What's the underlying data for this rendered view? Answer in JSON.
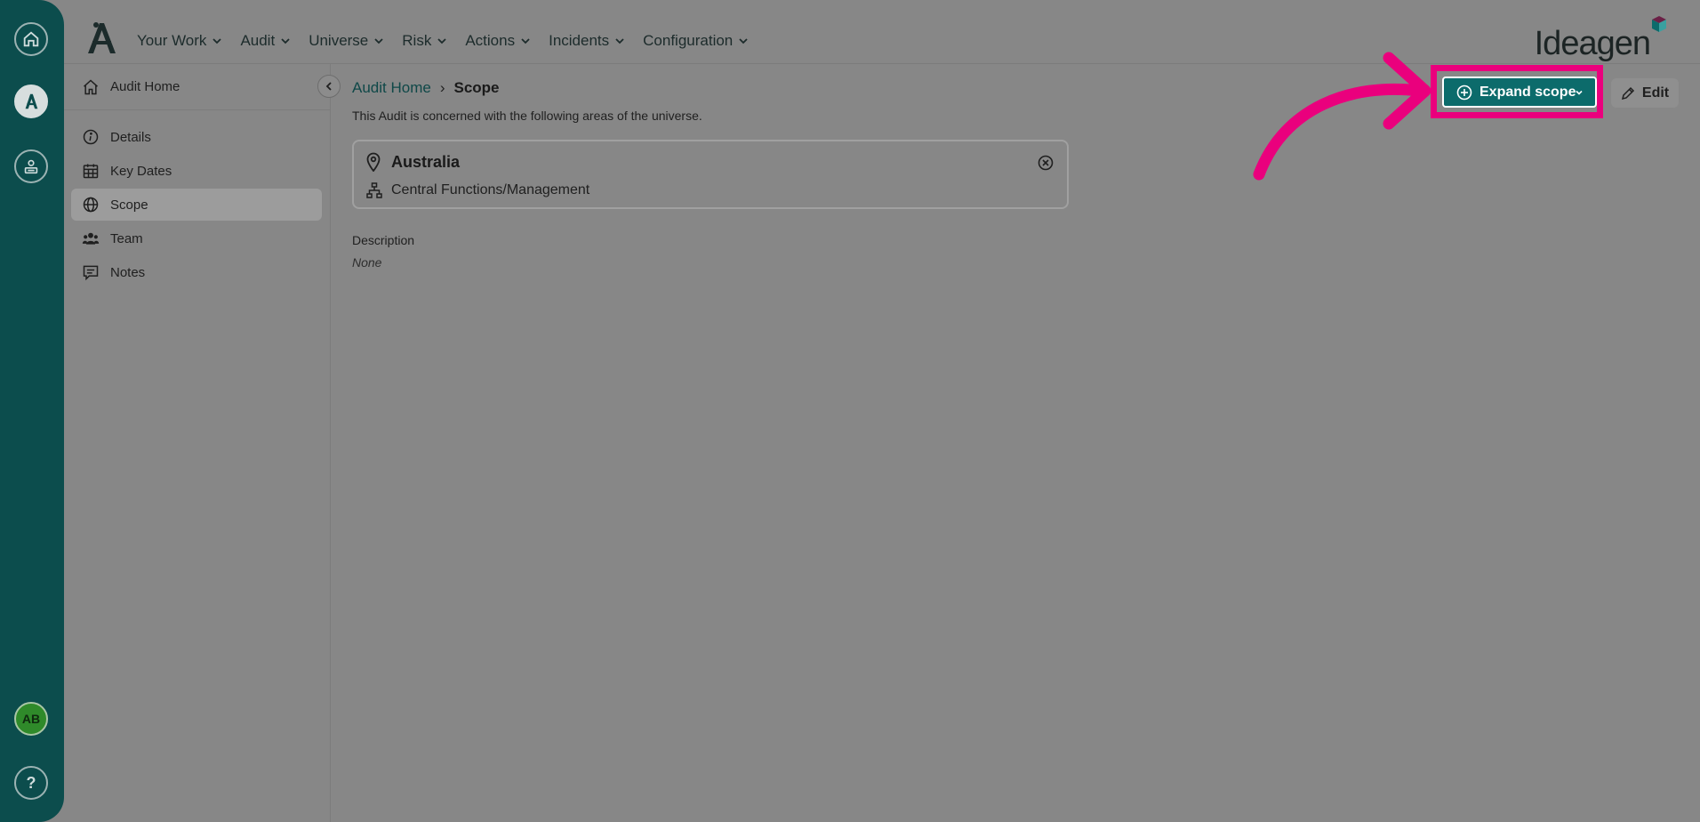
{
  "rail": {
    "icons": [
      "home-icon",
      "app-logo-icon",
      "person-list-icon"
    ],
    "avatar_initials": "AB",
    "help_label": "?"
  },
  "topbar": {
    "nav": [
      {
        "label": "Your Work"
      },
      {
        "label": "Audit"
      },
      {
        "label": "Universe"
      },
      {
        "label": "Risk"
      },
      {
        "label": "Actions"
      },
      {
        "label": "Incidents"
      },
      {
        "label": "Configuration"
      }
    ],
    "brand": "Ideagen"
  },
  "subnav": {
    "home_label": "Audit Home",
    "items": [
      {
        "label": "Details",
        "icon": "info-icon"
      },
      {
        "label": "Key Dates",
        "icon": "calendar-icon"
      },
      {
        "label": "Scope",
        "icon": "globe-icon",
        "active": true
      },
      {
        "label": "Team",
        "icon": "team-icon"
      },
      {
        "label": "Notes",
        "icon": "notes-icon"
      }
    ]
  },
  "main": {
    "breadcrumb": {
      "parent": "Audit Home",
      "separator": "›",
      "current": "Scope"
    },
    "intro": "This Audit is concerned with the following areas of the universe.",
    "scope": {
      "location": "Australia",
      "unit": "Central Functions/Management"
    },
    "description_label": "Description",
    "description_value": "None"
  },
  "actions": {
    "expand_label": "Expand scope",
    "edit_label": "Edit"
  },
  "colors": {
    "rail": "#0c4d4d",
    "primary_button": "#0c6b6b",
    "highlight": "#ea007d",
    "overlay_bg": "#878787"
  }
}
